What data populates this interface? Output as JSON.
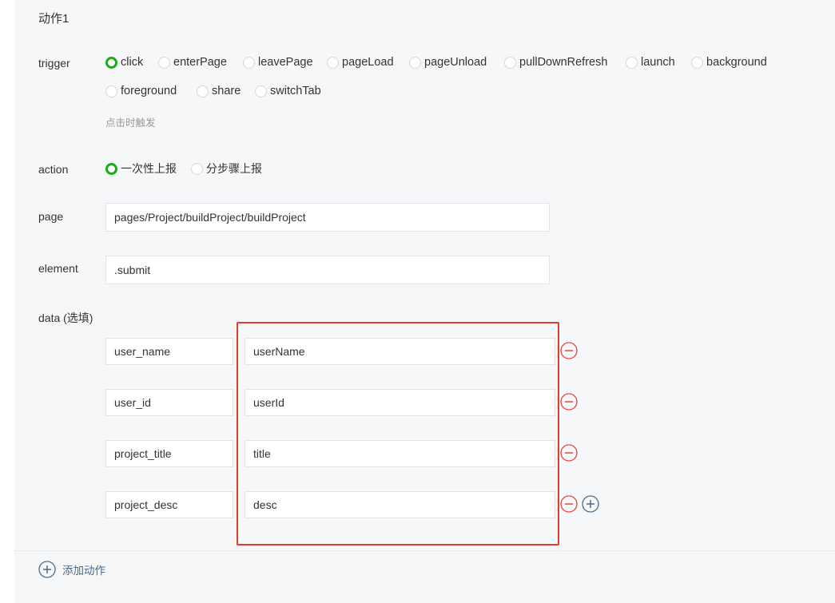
{
  "section_title": "动作1",
  "trigger": {
    "label": "trigger",
    "options": [
      "click",
      "enterPage",
      "leavePage",
      "pageLoad",
      "pageUnload",
      "pullDownRefresh",
      "launch",
      "background",
      "foreground",
      "share",
      "switchTab"
    ],
    "selected": "click",
    "hint": "点击时触发"
  },
  "action": {
    "label": "action",
    "options": [
      "一次性上报",
      "分步骤上报"
    ],
    "selected": "一次性上报"
  },
  "page": {
    "label": "page",
    "value": "pages/Project/buildProject/buildProject"
  },
  "element": {
    "label": "element",
    "value": ".submit"
  },
  "data": {
    "label": "data (选填)",
    "rows": [
      {
        "key": "user_name",
        "value": "userName"
      },
      {
        "key": "user_id",
        "value": "userId"
      },
      {
        "key": "project_title",
        "value": "title"
      },
      {
        "key": "project_desc",
        "value": "desc"
      }
    ]
  },
  "footer": {
    "add_action_label": "添加动作"
  },
  "colors": {
    "accent_green": "#1aad19",
    "remove_red": "#e8453c",
    "add_blue": "#4c6b8a",
    "highlight_red": "#e23a2e"
  },
  "icons": {
    "remove": "minus-circle-icon",
    "add": "plus-circle-icon"
  }
}
